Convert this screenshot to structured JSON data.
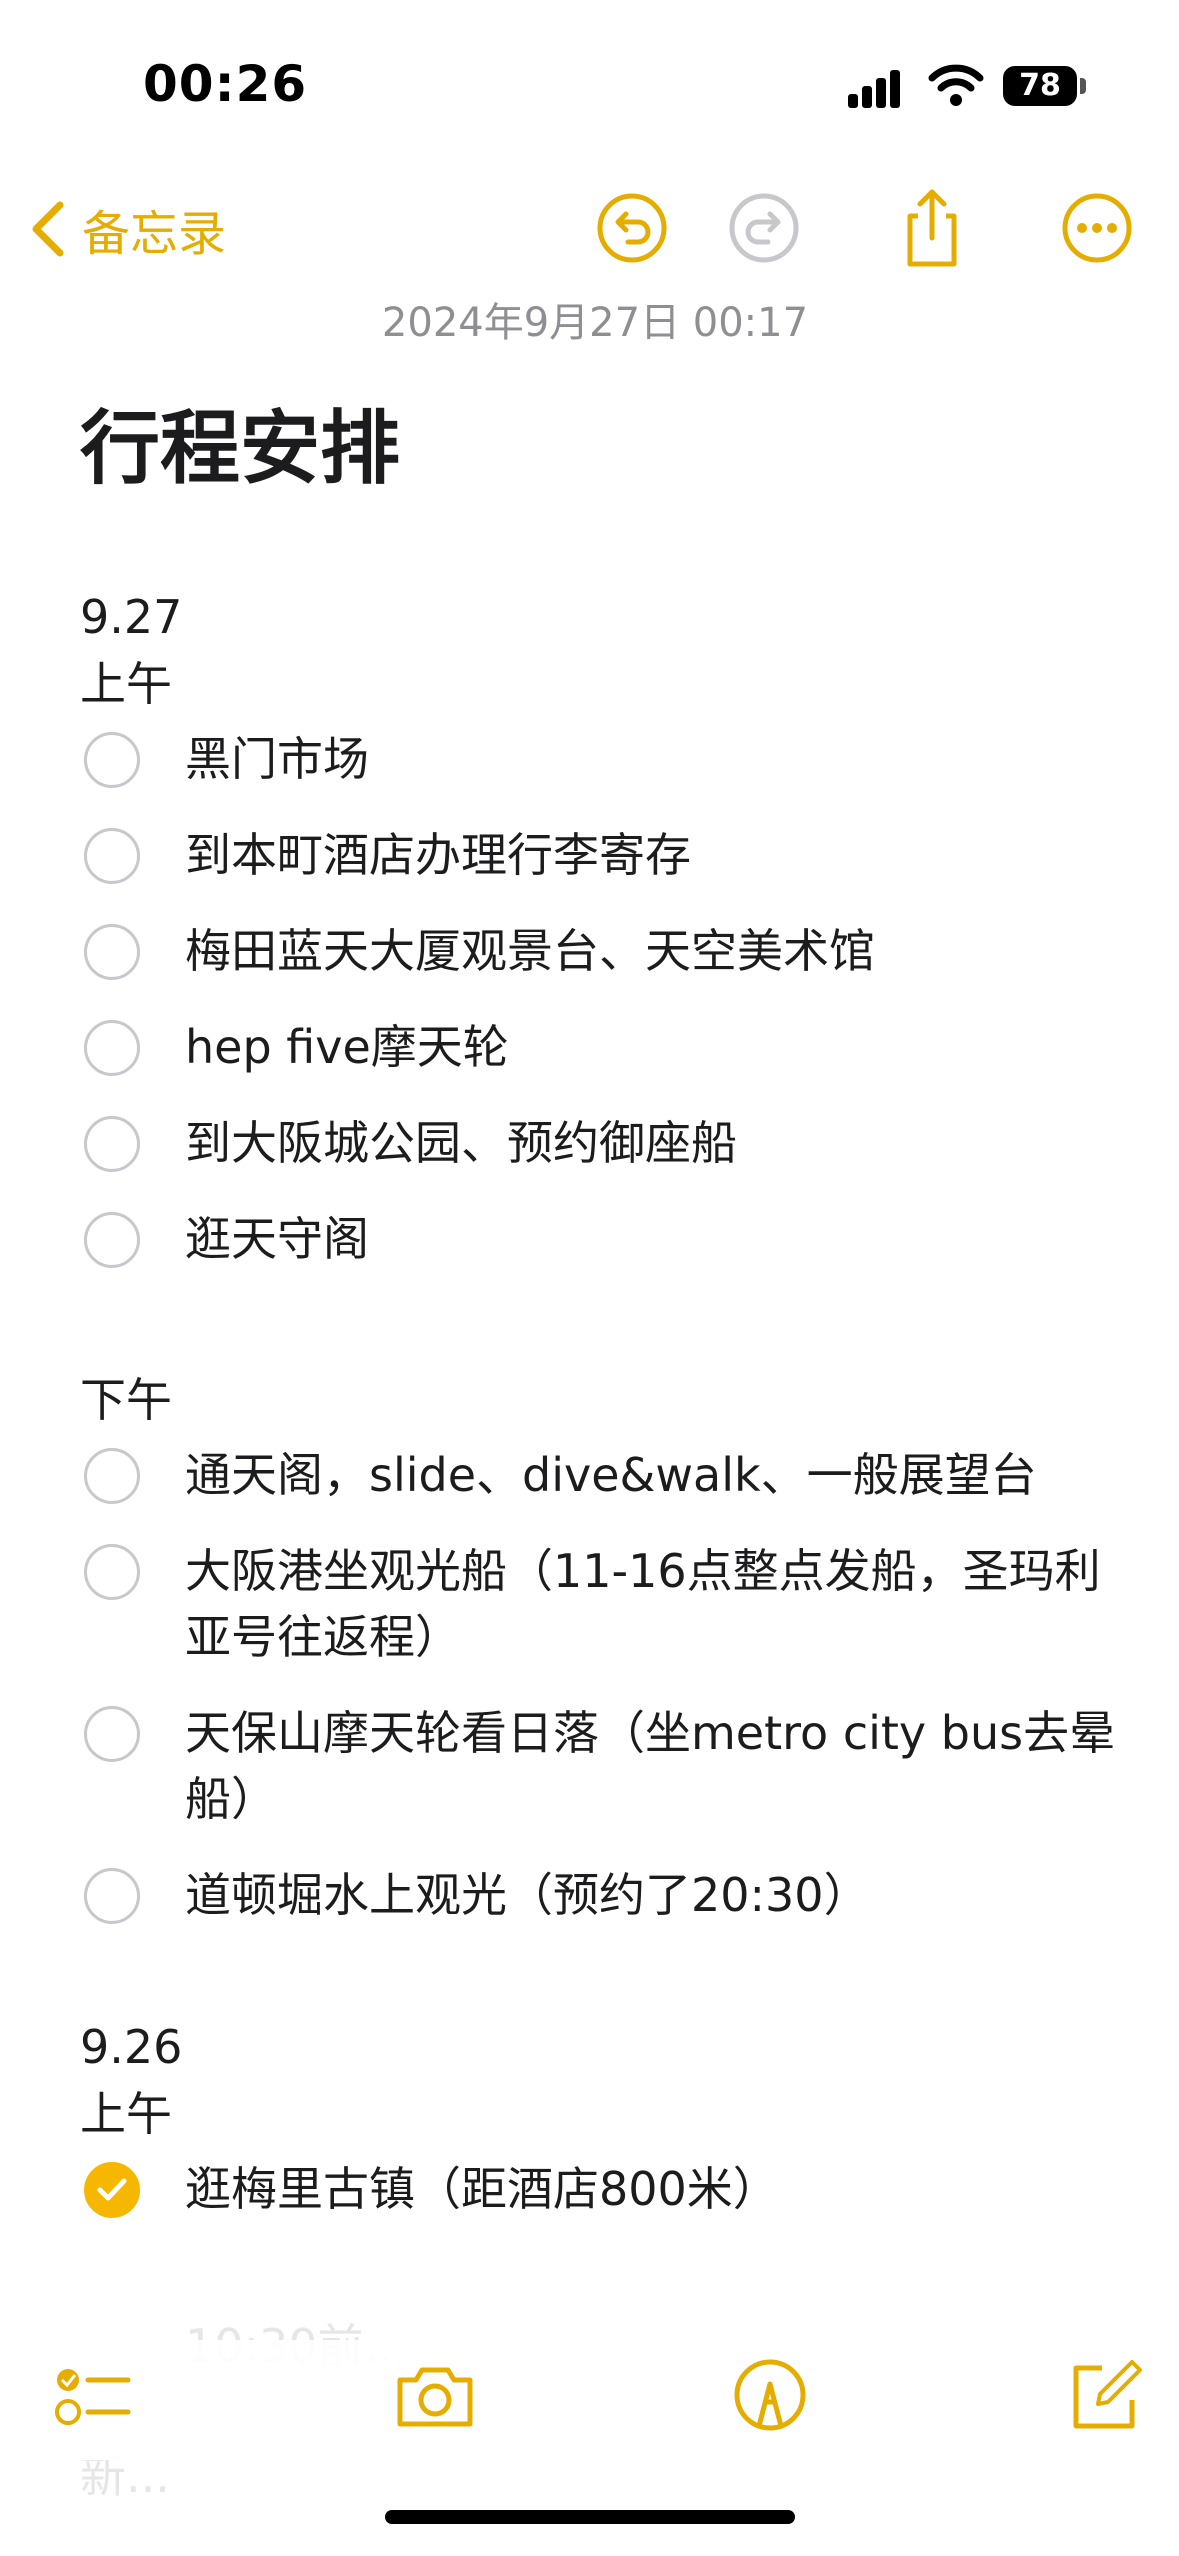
{
  "status": {
    "time": "00:26",
    "battery": "78"
  },
  "nav": {
    "back_label": "备忘录"
  },
  "note": {
    "date": "2024年9月27日 00:17",
    "title": "行程安排",
    "day1": {
      "date": "9.27",
      "morning_label": "上午",
      "morning": [
        "黑门市场",
        "到本町酒店办理行李寄存",
        "梅田蓝天大厦观景台、天空美术馆",
        "hep five摩天轮",
        "到大阪城公园、预约御座船",
        "逛天守阁"
      ],
      "afternoon_label": "下午",
      "afternoon": [
        "通天阁，slide、dive&walk、一般展望台",
        "大阪港坐观光船（11-16点整点发船，圣玛利亚号往返程）",
        "天保山摩天轮看日落（坐metro city bus去晕船）",
        "道顿堀水上观光（预约了20:30）"
      ]
    },
    "day2": {
      "date": "9.26",
      "morning_label": "上午",
      "tasks": [
        "逛梅里古镇（距酒店800米）"
      ],
      "faded_lines": [
        "10:30前...",
        "新..."
      ]
    }
  },
  "colors": {
    "accent": "#e4ad00",
    "check_fill": "#f5b700",
    "secondary": "#8e8e93"
  },
  "icons": [
    "chevron-left-icon",
    "undo-icon",
    "redo-icon",
    "share-icon",
    "more-icon",
    "checklist-icon",
    "camera-icon",
    "markup-icon",
    "compose-icon"
  ]
}
